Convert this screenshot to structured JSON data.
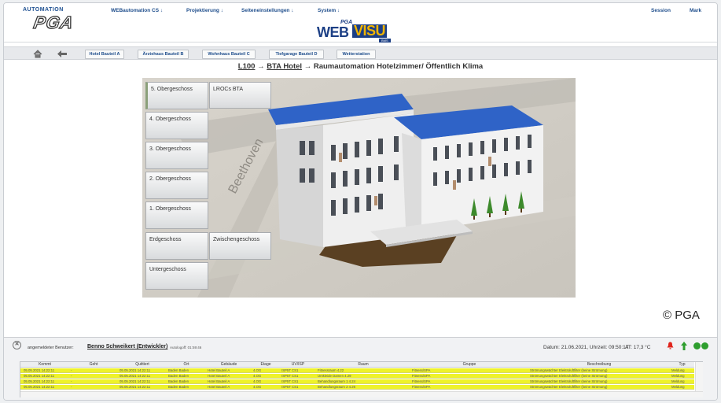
{
  "header": {
    "brand_top": "AUTOMATION",
    "brand_main": "PGA",
    "menu": [
      {
        "label": "WEBautomation CS ↓"
      },
      {
        "label": "Projektierung ↓"
      },
      {
        "label": "Seiteneinstellungen ↓"
      },
      {
        "label": "System ↓"
      }
    ],
    "session_label": "Session",
    "user_short": "Mark",
    "product_logo": {
      "pga": "PGA",
      "web": "WEB",
      "visu": "VISU",
      "bms": "BMS"
    }
  },
  "tabs": [
    {
      "label": "Hotel Bauteil A"
    },
    {
      "label": "Ärztehaus Bauteil B"
    },
    {
      "label": "Wohnhaus Bauteil C"
    },
    {
      "label": "Tiefgarage Bauteil D"
    },
    {
      "label": "Wetterstation"
    }
  ],
  "breadcrumb": {
    "root": "L100",
    "arrow1": " → ",
    "building": "BTA Hotel",
    "rest": " → Raumautomation Hotelzimmer/ Öffentlich Klima"
  },
  "floors": [
    {
      "label": "5. Obergeschoss"
    },
    {
      "label": "LROCs BTA"
    },
    {
      "label": "4. Obergeschoss"
    },
    {
      "label": "3. Obergeschoss"
    },
    {
      "label": "2. Obergeschoss"
    },
    {
      "label": "1. Obergeschoss"
    },
    {
      "label": "Erdgeschoss"
    },
    {
      "label": "Zwischengeschoss"
    },
    {
      "label": "Untergeschoss"
    }
  ],
  "street_label": "Beethoven",
  "copyright": "© PGA",
  "status": {
    "close_glyph": "✕",
    "user_label": "angemeldeter Benutzer:",
    "user_name": "Benno Schweikert (Entwickler)",
    "autologoff": "Autologoff: 01:59:46",
    "datetime": "Datum: 21.06.2021, Uhrzeit: 09:50:17",
    "at": "AT: 17,3 °C",
    "colors": {
      "alarm": "#e0231b",
      "ok": "#2e9e2e",
      "row": "#eef22a"
    }
  },
  "table": {
    "headers": [
      "Kommt",
      "Geht",
      "Quittiert",
      "Ort",
      "Gebäude",
      "Etage",
      "UV/ISP",
      "Raum",
      "Gruppe",
      "Beschreibung",
      "Typ"
    ],
    "rows": [
      [
        "05.05.2021 14:22:11",
        "-",
        "05.05.2021 14:22:11",
        "Baden Baden",
        "Hotel Bauteil A",
        "4.OG",
        "ISP5T CS1",
        "Fitnessraum 4.22",
        "Fitness/SPA",
        "Strömungswächter Elektroluftfilter (keine Strömung)",
        "Meldung"
      ],
      [
        "05.05.2021 14:22:11",
        "-",
        "05.05.2021 14:22:11",
        "Baden Baden",
        "Hotel Bauteil A",
        "4.OG",
        "ISP5T CS1",
        "Umkleide Damen 4.29",
        "Fitness/SPA",
        "Strömungswächter Elektroluftfilter (keine Strömung)",
        "Meldung"
      ],
      [
        "05.05.2021 14:22:11",
        "-",
        "05.05.2021 14:22:11",
        "Baden Baden",
        "Hotel Bauteil A",
        "4.OG",
        "ISP5T CS1",
        "Behandlungsraum 1 4.24",
        "Fitness/SPA",
        "Strömungswächter Elektroluftfilter (keine Strömung)",
        "Meldung"
      ],
      [
        "05.05.2021 14:22:11",
        "-",
        "05.05.2021 14:22:11",
        "Baden Baden",
        "Hotel Bauteil A",
        "4.OG",
        "ISP5T CS1",
        "Behandlungsraum 2 4.26",
        "Fitness/SPA",
        "Strömungswächter Elektroluftfilter (keine Strömung)",
        "Meldung"
      ]
    ]
  }
}
